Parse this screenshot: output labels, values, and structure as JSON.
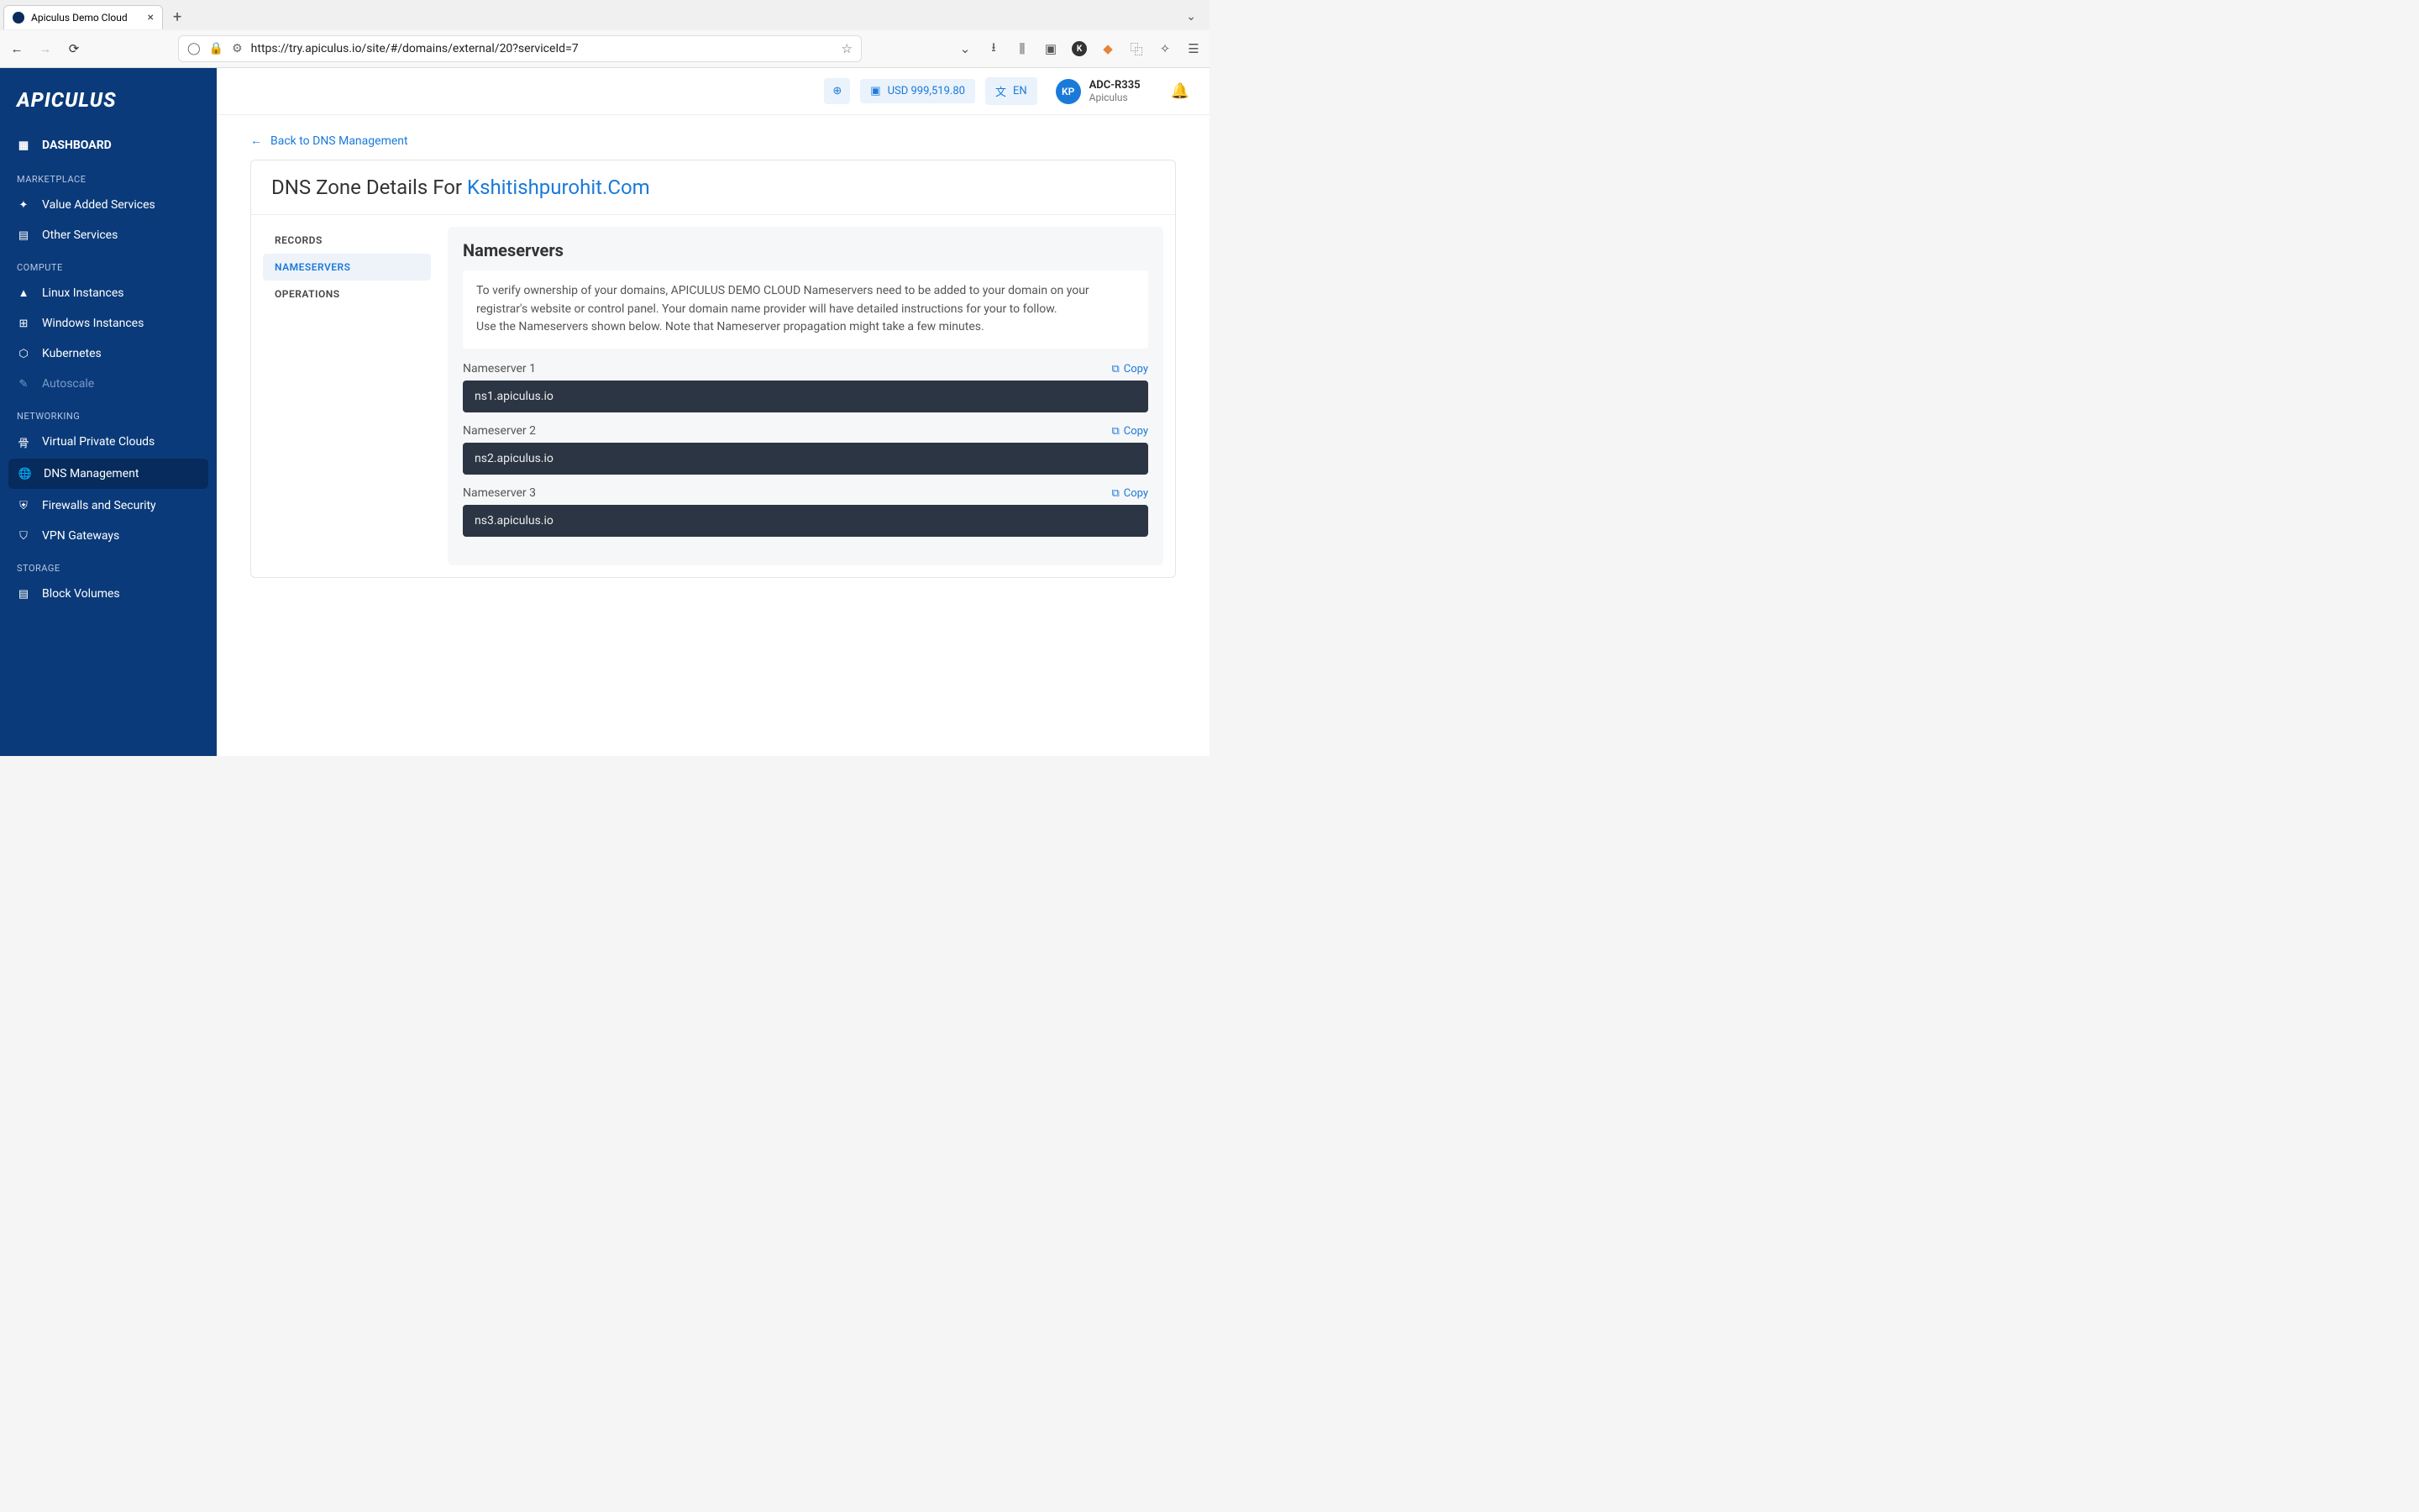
{
  "browser": {
    "tab_title": "Apiculus Demo Cloud",
    "url": "https://try.apiculus.io/site/#/domains/external/20?serviceId=7"
  },
  "topbar": {
    "balance": "USD 999,519.80",
    "lang": "EN",
    "avatar_initials": "KP",
    "user_name": "ADC-R335",
    "user_org": "Apiculus"
  },
  "sidebar": {
    "logo": "APICULUS",
    "dashboard": "DASHBOARD",
    "sections": {
      "marketplace": "MARKETPLACE",
      "compute": "COMPUTE",
      "networking": "NETWORKING",
      "storage": "STORAGE"
    },
    "items": {
      "vas": "Value Added Services",
      "other": "Other Services",
      "linux": "Linux Instances",
      "windows": "Windows Instances",
      "k8s": "Kubernetes",
      "autoscale": "Autoscale",
      "vpc": "Virtual Private Clouds",
      "dns": "DNS Management",
      "firewall": "Firewalls and Security",
      "vpn": "VPN Gateways",
      "block": "Block Volumes"
    }
  },
  "content": {
    "back_label": "Back to DNS Management",
    "title_prefix": "DNS Zone Details For ",
    "domain": "Kshitishpurohit.Com",
    "tabs": {
      "records": "RECORDS",
      "nameservers": "NAMESERVERS",
      "operations": "OPERATIONS"
    },
    "section_title": "Nameservers",
    "info_line1": "To verify ownership of your domains, APICULUS DEMO CLOUD Nameservers need to be added to your domain on your registrar's website or control panel. Your domain name provider will have detailed instructions for your to follow.",
    "info_line2": "Use the Nameservers shown below. Note that Nameserver propagation might take a few minutes.",
    "copy_label": "Copy",
    "nameservers": [
      {
        "label": "Nameserver 1",
        "value": "ns1.apiculus.io"
      },
      {
        "label": "Nameserver 2",
        "value": "ns2.apiculus.io"
      },
      {
        "label": "Nameserver 3",
        "value": "ns3.apiculus.io"
      }
    ]
  }
}
